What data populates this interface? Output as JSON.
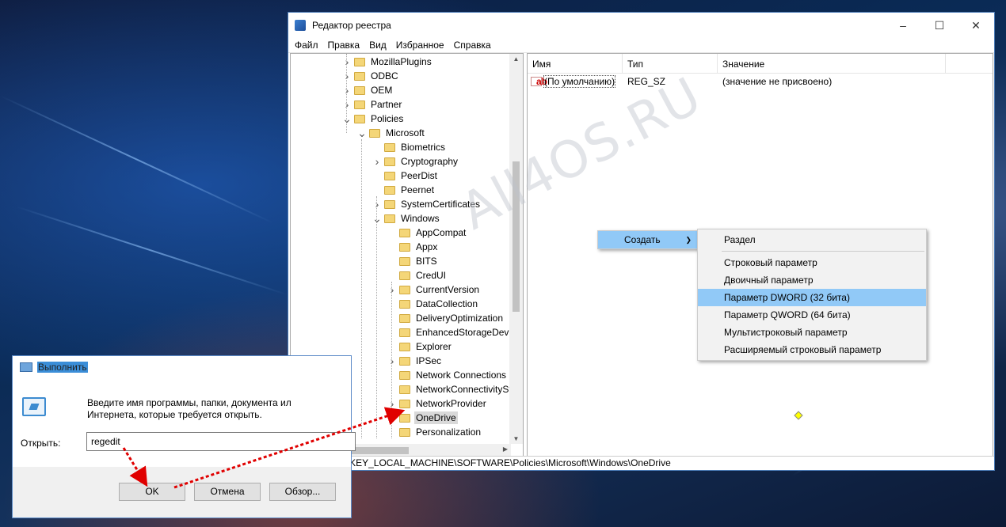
{
  "registry": {
    "title": "Редактор реестра",
    "menu": [
      "Файл",
      "Правка",
      "Вид",
      "Избранное",
      "Справка"
    ],
    "tree": [
      {
        "label": "MozillaPlugins",
        "level": 0,
        "chev": "right"
      },
      {
        "label": "ODBC",
        "level": 0,
        "chev": "right"
      },
      {
        "label": "OEM",
        "level": 0,
        "chev": "right"
      },
      {
        "label": "Partner",
        "level": 0,
        "chev": "right"
      },
      {
        "label": "Policies",
        "level": 0,
        "chev": "down"
      },
      {
        "label": "Microsoft",
        "level": 1,
        "chev": "down"
      },
      {
        "label": "Biometrics",
        "level": 2,
        "chev": ""
      },
      {
        "label": "Cryptography",
        "level": 2,
        "chev": "right"
      },
      {
        "label": "PeerDist",
        "level": 2,
        "chev": ""
      },
      {
        "label": "Peernet",
        "level": 2,
        "chev": ""
      },
      {
        "label": "SystemCertificates",
        "level": 2,
        "chev": "right"
      },
      {
        "label": "Windows",
        "level": 2,
        "chev": "down"
      },
      {
        "label": "AppCompat",
        "level": 3,
        "chev": ""
      },
      {
        "label": "Appx",
        "level": 3,
        "chev": ""
      },
      {
        "label": "BITS",
        "level": 3,
        "chev": ""
      },
      {
        "label": "CredUI",
        "level": 3,
        "chev": ""
      },
      {
        "label": "CurrentVersion",
        "level": 3,
        "chev": "right"
      },
      {
        "label": "DataCollection",
        "level": 3,
        "chev": ""
      },
      {
        "label": "DeliveryOptimization",
        "level": 3,
        "chev": ""
      },
      {
        "label": "EnhancedStorageDevic",
        "level": 3,
        "chev": ""
      },
      {
        "label": "Explorer",
        "level": 3,
        "chev": ""
      },
      {
        "label": "IPSec",
        "level": 3,
        "chev": "right"
      },
      {
        "label": "Network Connections",
        "level": 3,
        "chev": ""
      },
      {
        "label": "NetworkConnectivitySt",
        "level": 3,
        "chev": ""
      },
      {
        "label": "NetworkProvider",
        "level": 3,
        "chev": "right"
      },
      {
        "label": "OneDrive",
        "level": 3,
        "chev": "",
        "selected": true
      },
      {
        "label": "Personalization",
        "level": 3,
        "chev": ""
      }
    ],
    "columns": {
      "name": "Имя",
      "type": "Тип",
      "value": "Значение"
    },
    "values": [
      {
        "name": "(По умолчанию)",
        "type": "REG_SZ",
        "value": "(значение не присвоено)"
      }
    ],
    "status_path": "Компьютер\\HKEY_LOCAL_MACHINE\\SOFTWARE\\Policies\\Microsoft\\Windows\\OneDrive"
  },
  "context_menu": {
    "create_label": "Создать",
    "submenu": {
      "key": "Раздел",
      "string": "Строковый параметр",
      "binary": "Двоичный параметр",
      "dword": "Параметр DWORD (32 бита)",
      "qword": "Параметр QWORD (64 бита)",
      "multistring": "Мультистроковый параметр",
      "expandable": "Расширяемый строковый параметр"
    }
  },
  "run_dialog": {
    "title": "Выполнить",
    "description_line1": "Введите имя программы, папки, документа ил",
    "description_line2": "Интернета, которые требуется открыть.",
    "open_label": "Открыть:",
    "input_value": "regedit",
    "ok_label": "OK",
    "cancel_label": "Отмена",
    "browse_label": "Обзор..."
  },
  "watermark": "All4OS.RU",
  "colors": {
    "highlight": "#91c9f7",
    "arrow": "#e00000",
    "selected_row": "#d9d9d9"
  }
}
